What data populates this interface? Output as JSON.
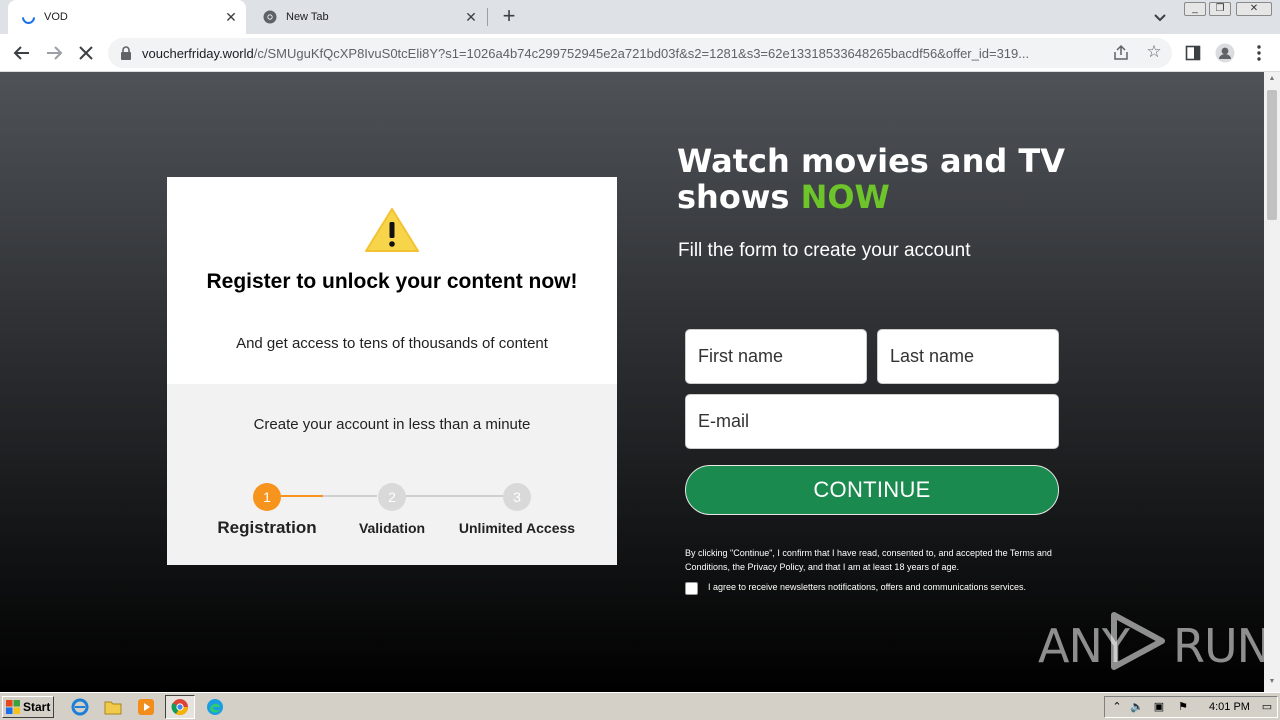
{
  "browser": {
    "tabs": [
      {
        "title": "VOD",
        "loading": true
      },
      {
        "title": "New Tab",
        "loading": false
      }
    ],
    "url_host": "voucherfriday.world",
    "url_path": "/c/SMUguKfQcXP8IvuS0tcEli8Y?s1=1026a4b74c299752945e2a721bd03f&s2=1281&s3=62e13318533648265bacdf56&offer_id=319..."
  },
  "card": {
    "title": "Register to unlock your content now!",
    "subtitle": "And get access to tens of thousands of content",
    "lead": "Create your account in less than a minute",
    "steps": [
      {
        "number": "1",
        "label": "Registration"
      },
      {
        "number": "2",
        "label": "Validation"
      },
      {
        "number": "3",
        "label": "Unlimited Access"
      }
    ],
    "current_step": 1
  },
  "hero": {
    "headline": "Watch movies and TV shows",
    "headline_accent": "NOW",
    "instruction": "Fill the form to create your account"
  },
  "form": {
    "first_name_placeholder": "First name",
    "last_name_placeholder": "Last name",
    "email_placeholder": "E-mail",
    "continue_label": "CONTINUE",
    "legal": "By clicking \"Continue\", I confirm that I have read, consented to, and accepted the Terms and Conditions, the Privacy Policy, and that I am at least 18 years of age.",
    "newsletter_label": "I agree to receive newsletters notifications, offers and communications services.",
    "newsletter_checked": false
  },
  "watermark": {
    "left": "ANY",
    "right": "RUN"
  },
  "taskbar": {
    "start_label": "Start",
    "clock": "4:01 PM"
  },
  "colors": {
    "accent_green": "#6dc52a",
    "button_green": "#1b8a4f",
    "step_orange": "#f7941d"
  }
}
